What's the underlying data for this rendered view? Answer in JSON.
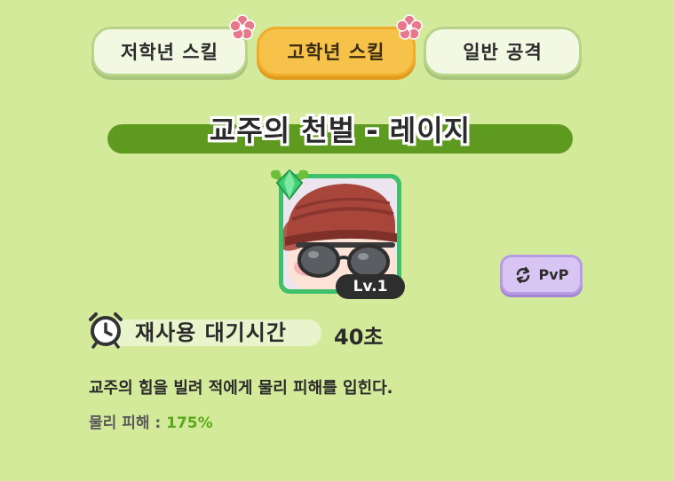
{
  "tabs": [
    {
      "label": "저학년 스킬",
      "active": false
    },
    {
      "label": "고학년 스킬",
      "active": true
    },
    {
      "label": "일반 공격",
      "active": false
    }
  ],
  "skill": {
    "name": "교주의 천벌 - 레이지",
    "level": "Lv.1",
    "cooldown_label": "재사용 대기시간",
    "cooldown_value": "40초",
    "description": "교주의 힘을 빌려 적에게 물리 피해를 입힌다.",
    "damage_label": "물리 피해 : ",
    "damage_value": "175%"
  },
  "pvp_button": {
    "label": "PvP",
    "icon": "swap-arrows-icon"
  },
  "colors": {
    "background": "#d2ea99",
    "active_tab": "#f6c24a",
    "title_bar": "#5e9a20",
    "portrait_frame": "#3fc06a",
    "pvp_button": "#d9c5f3",
    "damage_value": "#5aa81c"
  }
}
